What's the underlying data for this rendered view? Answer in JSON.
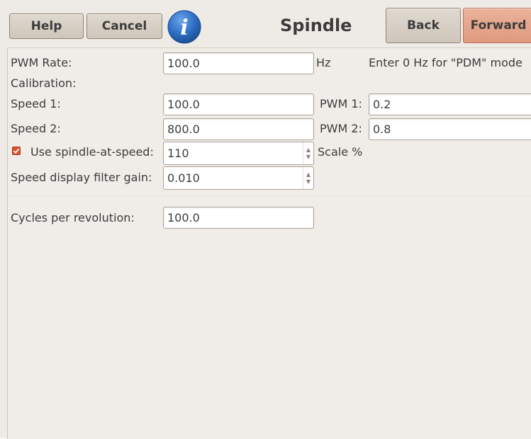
{
  "header": {
    "help_label": "Help",
    "cancel_label": "Cancel",
    "title": "Spindle",
    "back_label": "Back",
    "forward_label": "Forward",
    "info_glyph": "i",
    "info_icon": "info-icon"
  },
  "form": {
    "pwm_rate": {
      "label": "PWM Rate:",
      "value": "100.0",
      "unit": "Hz",
      "hint": "Enter 0 Hz for \"PDM\" mode"
    },
    "calibration_label": "Calibration:",
    "speed1": {
      "label": "Speed 1:",
      "value": "100.0",
      "pwm_label": "PWM 1:",
      "pwm_value": "0.2"
    },
    "speed2": {
      "label": "Speed 2:",
      "value": "800.0",
      "pwm_label": "PWM 2:",
      "pwm_value": "0.8"
    },
    "spindle_at_speed": {
      "label": "Use spindle-at-speed:",
      "checked": true,
      "value": "110",
      "unit": "Scale %"
    },
    "filter_gain": {
      "label": "Speed display filter gain:",
      "value": "0.010"
    },
    "cycles": {
      "label": "Cycles per revolution:",
      "value": "100.0"
    }
  },
  "colors": {
    "background": "#eeebe7",
    "button": "#d8d0c5",
    "forward_button": "#e6a68c",
    "info_icon": "#2e6fc4",
    "checkbox": "#e0502a"
  }
}
